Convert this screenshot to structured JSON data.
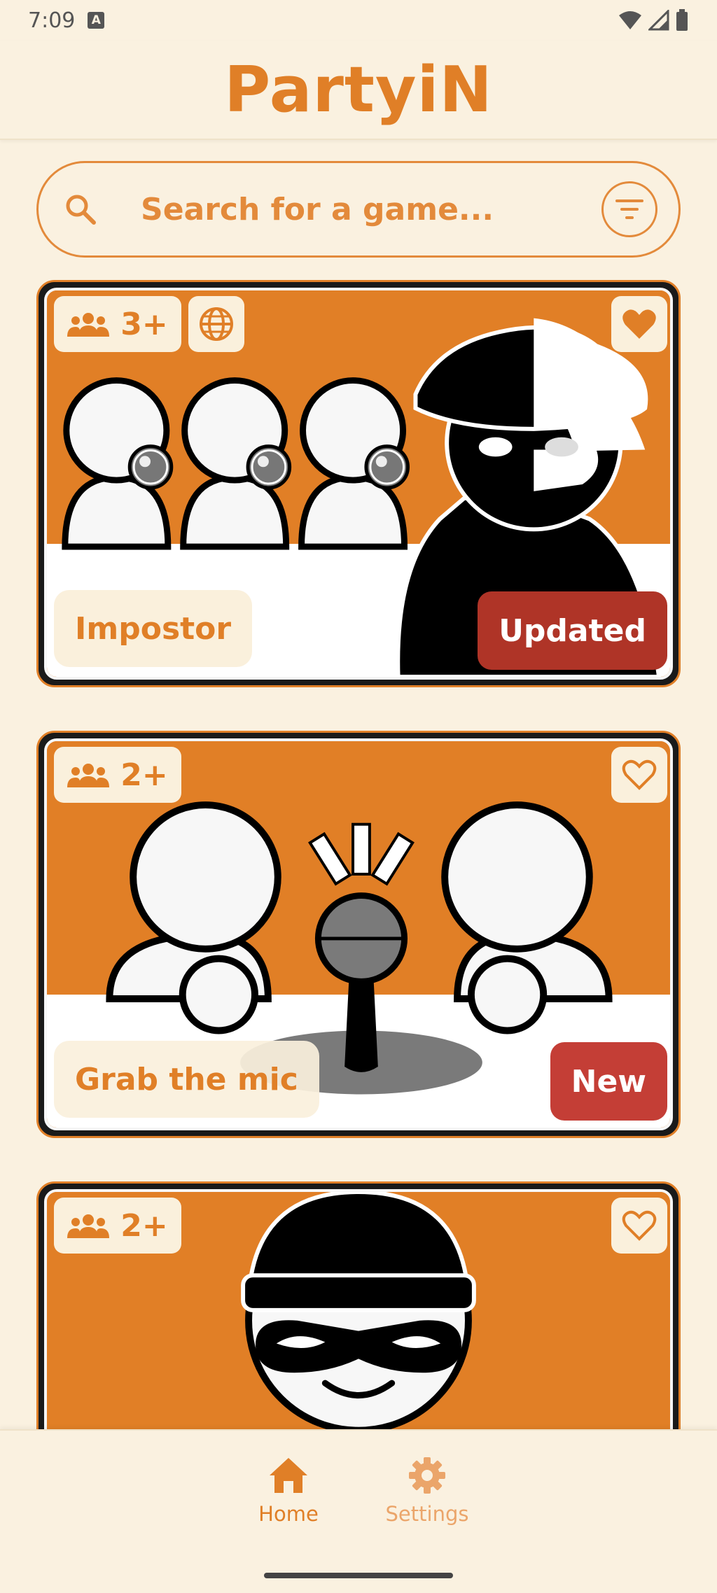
{
  "status_bar": {
    "time": "7:09",
    "notification_letter": "A"
  },
  "header": {
    "title": "PartyiN"
  },
  "search": {
    "placeholder": "Search for a game..."
  },
  "games": [
    {
      "name": "Impostor",
      "players": "3+",
      "has_globe": true,
      "favorited": true,
      "status": "Updated",
      "status_color": "#AF3427"
    },
    {
      "name": "Grab the mic",
      "players": "2+",
      "has_globe": false,
      "favorited": false,
      "status": "New",
      "status_color": "#C43E36"
    },
    {
      "name": "",
      "players": "2+",
      "has_globe": false,
      "favorited": false,
      "status": "",
      "status_color": ""
    }
  ],
  "nav": {
    "home_label": "Home",
    "settings_label": "Settings"
  },
  "colors": {
    "accent": "#E07F27",
    "background": "#FAF1E0",
    "card_art": "#E17F26",
    "chip": "#FAF0DC"
  },
  "icons": [
    "search-icon",
    "filter-icon",
    "people-icon",
    "globe-icon",
    "heart-icon",
    "home-icon",
    "gear-icon"
  ]
}
